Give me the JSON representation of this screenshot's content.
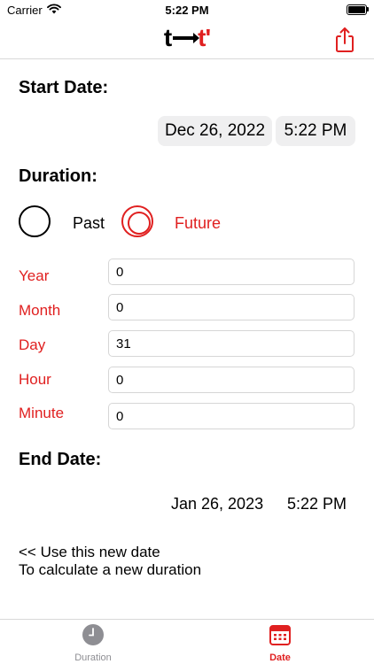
{
  "status_bar": {
    "carrier": "Carrier",
    "time": "5:22 PM"
  },
  "header": {
    "logo_left": "t",
    "logo_right": "t'"
  },
  "start": {
    "title": "Start Date:",
    "date": "Dec 26, 2022",
    "time": "5:22 PM"
  },
  "duration": {
    "title": "Duration:",
    "options": [
      {
        "label": "Past",
        "selected": false
      },
      {
        "label": "Future",
        "selected": true
      }
    ],
    "fields": [
      {
        "label": "Year",
        "value": "0"
      },
      {
        "label": "Month",
        "value": "0"
      },
      {
        "label": "Day",
        "value": "31"
      },
      {
        "label": "Hour",
        "value": "0"
      },
      {
        "label": "Minute",
        "value": "0"
      }
    ]
  },
  "end": {
    "title": "End Date:",
    "date": "Jan 26, 2023",
    "time": "5:22 PM"
  },
  "use_new_date": {
    "line1": "<< Use this new date",
    "line2": "To calculate a new duration"
  },
  "tabs": [
    {
      "label": "Duration",
      "active": false
    },
    {
      "label": "Date",
      "active": true
    }
  ],
  "colors": {
    "accent": "#e02020",
    "pill_bg": "#efeff0",
    "inactive": "#8e8e93"
  }
}
